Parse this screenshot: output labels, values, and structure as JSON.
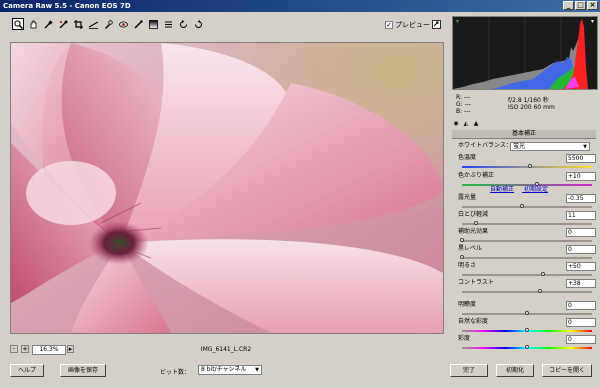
{
  "window": {
    "title": "Camera Raw 5.5  -  Canon EOS 7D",
    "minimize_glyph": "_",
    "maximize_glyph": "□",
    "close_glyph": "×"
  },
  "toolbar": {
    "tools": [
      "zoom-icon",
      "hand-icon",
      "eyedropper-icon",
      "color-sampler-icon",
      "crop-icon",
      "straighten-icon",
      "spot-removal-icon",
      "redeye-icon",
      "adjustment-brush-icon",
      "graduated-filter-icon",
      "list-icon",
      "rotate-ccw-icon",
      "rotate-cw-icon"
    ],
    "preview_label": "プレビュー",
    "preview_checked": "✓"
  },
  "statusbar": {
    "zoom_minus": "-",
    "zoom_plus": "+",
    "zoom_value": "16.3%",
    "filename": "IMG_6141_L.CR2"
  },
  "info": {
    "r_label": "R:",
    "r_value": "---",
    "g_label": "G:",
    "g_value": "---",
    "b_label": "B:",
    "b_value": "---",
    "aperture_shutter": "f/2.8   1/160 秒",
    "iso_focal": "ISO 200    60 mm"
  },
  "panel": {
    "title": "基本補正",
    "wb_label": "ホワイトバランス：",
    "wb_value": "蛍光",
    "dropdown_glyph": "▼",
    "temp_label": "色温度",
    "temp_value": "5500",
    "temp_level": 0.52,
    "tint_label": "色かぶり補正",
    "tint_value": "+10",
    "tint_level": 0.58,
    "auto_label": "自動補正",
    "default_label": "初期設定",
    "exposure_label": "露光量",
    "exposure_value": "-0.35",
    "exposure_level": 0.46,
    "recovery_label": "白とび軽減",
    "recovery_value": "11",
    "recovery_level": 0.11,
    "fill_label": "補助光効果",
    "fill_value": "0",
    "fill_level": 0.0,
    "blacks_label": "黒レベル",
    "blacks_value": "0",
    "blacks_level": 0.0,
    "brightness_label": "明るさ",
    "brightness_value": "+50",
    "brightness_level": 0.62,
    "contrast_label": "コントラスト",
    "contrast_value": "+38",
    "contrast_level": 0.6,
    "clarity_label": "明瞭度",
    "clarity_value": "0",
    "clarity_level": 0.5,
    "vibrance_label": "自然な彩度",
    "vibrance_value": "0",
    "vibrance_level": 0.5,
    "saturation_label": "彩度",
    "saturation_value": "0",
    "saturation_level": 0.5
  },
  "bottom": {
    "help": "ヘルプ",
    "save": "画像を保存",
    "depth_label": "ビット数：",
    "depth_value": "8 bit/チャンネル",
    "done": "完了",
    "reset": "初期化",
    "open_copy": "コピーを開く"
  }
}
